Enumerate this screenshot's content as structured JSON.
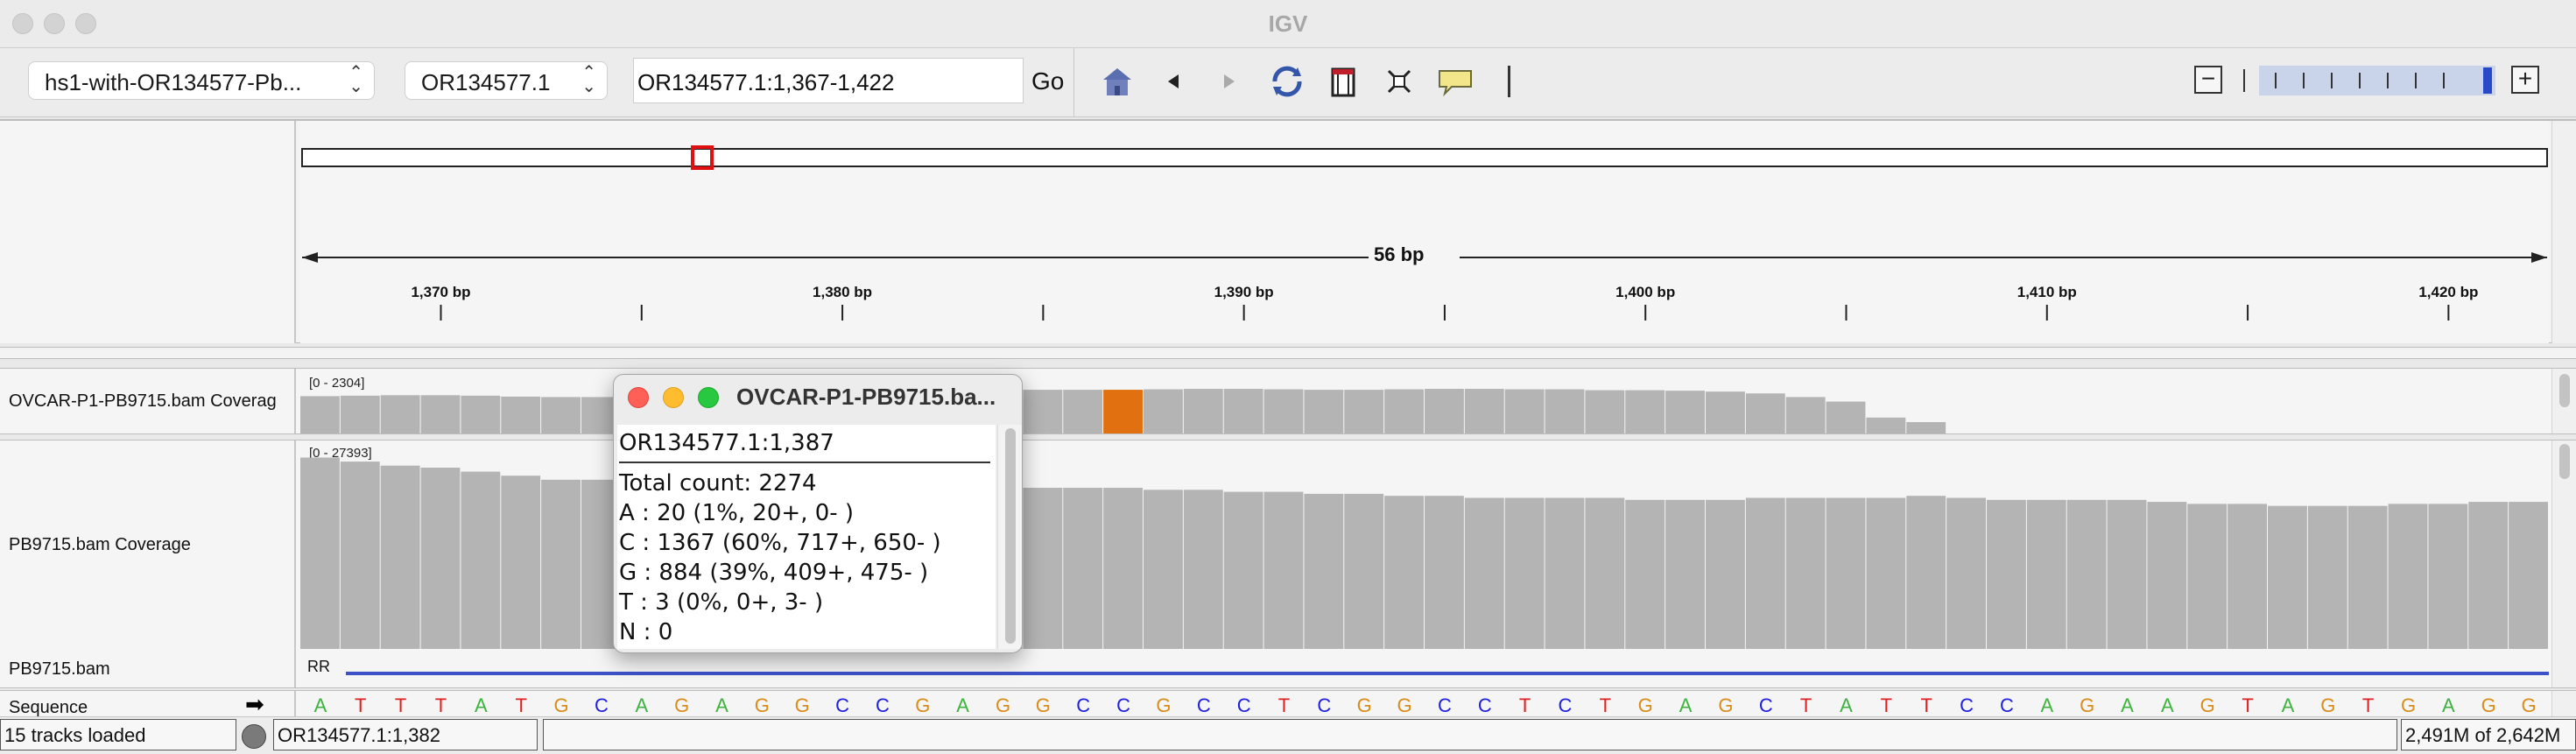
{
  "window": {
    "title": "IGV"
  },
  "toolbar": {
    "genome": "hs1-with-OR134577-Pb...",
    "chromosome": "OR134577.1",
    "locus": "OR134577.1:1,367-1,422",
    "go_label": "Go",
    "icons": [
      "home-icon",
      "back-arrow-icon",
      "forward-arrow-icon",
      "refresh-icon",
      "region-of-interest-icon",
      "resize-tracks-icon",
      "popup-info-icon",
      "ruler-divider"
    ]
  },
  "ruler": {
    "span_label": "56 bp",
    "ticks": [
      "1,370 bp",
      "1,380 bp",
      "1,390 bp",
      "1,400 bp",
      "1,410 bp",
      "1,420 bp"
    ]
  },
  "tracks": {
    "coverage1": {
      "name": "OVCAR-P1-PB9715.bam Coverag",
      "range": "[0 - 2304]",
      "values": [
        0.82,
        0.83,
        0.84,
        0.84,
        0.83,
        0.81,
        0.8,
        0.8,
        0.85,
        0.9,
        0.92,
        0.93,
        0.93,
        0.93,
        0.93,
        0.93,
        0.95,
        0.95,
        0.96,
        0.96,
        0.96,
        0.97,
        0.98,
        0.98,
        0.97,
        0.96,
        0.96,
        0.97,
        0.98,
        0.98,
        0.97,
        0.97,
        0.95,
        0.95,
        0.94,
        0.92,
        0.88,
        0.8,
        0.7,
        0.35,
        0.25
      ]
    },
    "coverage2": {
      "name": "PB9715.bam Coverage",
      "range": "[0 - 27393]",
      "values": [
        0.95,
        0.93,
        0.91,
        0.9,
        0.88,
        0.86,
        0.84,
        0.84,
        0.85,
        0.85,
        0.84,
        0.83,
        0.83,
        0.82,
        0.82,
        0.82,
        0.81,
        0.81,
        0.8,
        0.8,
        0.8,
        0.79,
        0.79,
        0.78,
        0.78,
        0.77,
        0.77,
        0.76,
        0.76,
        0.75,
        0.75,
        0.75,
        0.75,
        0.74,
        0.74,
        0.74,
        0.75,
        0.75,
        0.75,
        0.75,
        0.76,
        0.75,
        0.74,
        0.74,
        0.74,
        0.74,
        0.73,
        0.72,
        0.72,
        0.71,
        0.71,
        0.71,
        0.72,
        0.72,
        0.73,
        0.73
      ]
    },
    "alignment": {
      "name": "PB9715.bam",
      "label": "RR"
    },
    "sequence": {
      "name": "Sequence",
      "bases": "ATTTATGCAGAGGCCGAGGCCGCCTCGGCCTCTGAGCTATTCCAGAAGTAGTGAGG"
    }
  },
  "colors": {
    "A": "#3fb33f",
    "C": "#2020e0",
    "G": "#d98c1a",
    "T": "#e02020",
    "mismatch": "#e07010",
    "coverage": "#b4b4b4"
  },
  "popup": {
    "title": "OVCAR-P1-PB9715.ba...",
    "locus": "OR134577.1:1,387",
    "total": "Total count: 2274",
    "a": "A : 20 (1%, 20+, 0- )",
    "c": "C : 1367 (60%, 717+, 650- )",
    "g": "G : 884 (39%, 409+, 475- )",
    "t": "T : 3 (0%, 0+, 3- )",
    "n": "N : 0"
  },
  "status": {
    "tracks_loaded": "15 tracks loaded",
    "position": "OR134577.1:1,382",
    "memory": "2,491M of 2,642M"
  }
}
